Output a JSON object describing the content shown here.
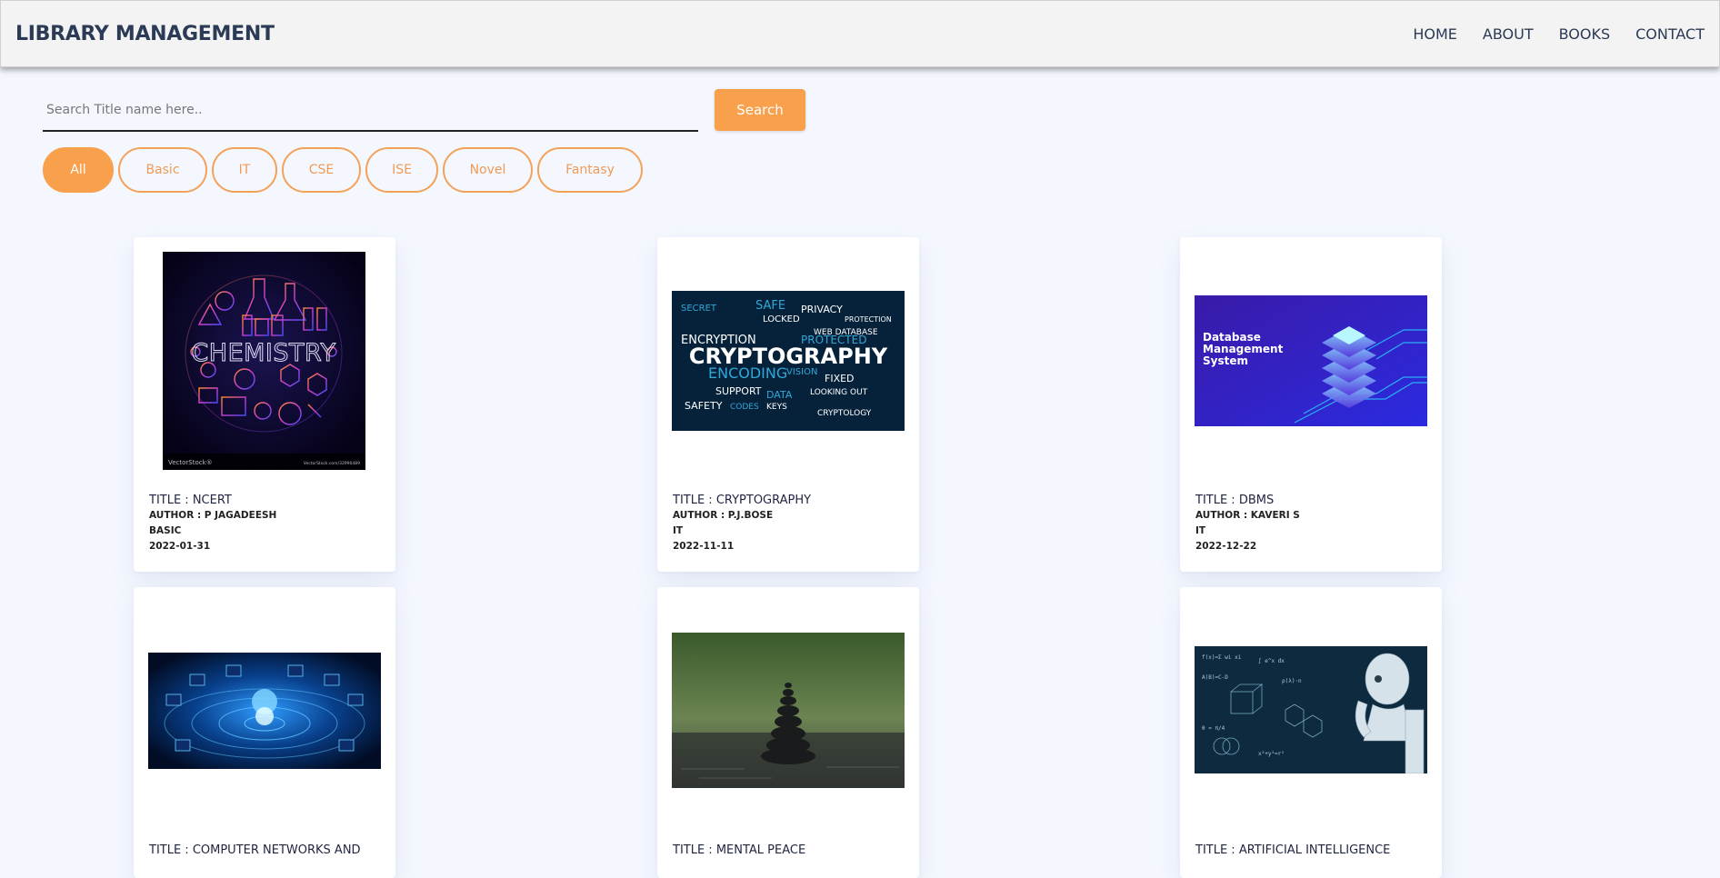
{
  "navbar": {
    "brand": "LIBRARY MANAGEMENT",
    "links": [
      "HOME",
      "ABOUT",
      "BOOKS",
      "CONTACT"
    ]
  },
  "search": {
    "placeholder": "Search Title name here..",
    "value": "",
    "button_label": "Search"
  },
  "filters": {
    "active": "All",
    "items": [
      "All",
      "Basic",
      "IT",
      "CSE",
      "ISE",
      "Novel",
      "Fantasy"
    ]
  },
  "colors": {
    "accent": "#f9a04d",
    "background": "#f4f7fe",
    "brand_text": "#2b3a55"
  },
  "books": [
    {
      "title": "TITLE : NCERT",
      "author": "AUTHOR : P JAGADEESH",
      "category": "BASIC",
      "date": "2022-01-31",
      "image": "chemistry-cover",
      "image_text": "CHEMISTRY",
      "image_footer_left": "VectorStock®",
      "image_footer_right": "VectorStock.com/32990489"
    },
    {
      "title": "TITLE : CRYPTOGRAPHY",
      "author": "AUTHOR : P.J.BOSE",
      "category": "IT",
      "date": "2022-11-11",
      "image": "cryptography-word-cloud",
      "image_text": "CRYPTOGRAPHY",
      "image_words": [
        "SECRET",
        "SAFE",
        "PRIVACY",
        "PROTECTION",
        "LOCKED",
        "ENCRYPTION",
        "PROTECTED",
        "ENCODING",
        "VISION",
        "FIXED",
        "SUPPORT",
        "DATA",
        "SAFETY",
        "KEYS",
        "CODES",
        "CRYPTOLOGY",
        "WEB DATABASE",
        "LOOKING OUT"
      ]
    },
    {
      "title": "TITLE : DBMS",
      "author": "AUTHOR : KAVERI S",
      "category": "IT",
      "date": "2022-12-22",
      "image": "database-server-illustration",
      "image_text": "Database Management System"
    },
    {
      "title": "TITLE : COMPUTER NETWORKS AND",
      "image": "network-globe-illustration"
    },
    {
      "title": "TITLE : MENTAL PEACE",
      "image": "stacked-stones-photo"
    },
    {
      "title": "TITLE : ARTIFICIAL INTELLIGENCE",
      "image": "robot-thinking-illustration"
    }
  ]
}
